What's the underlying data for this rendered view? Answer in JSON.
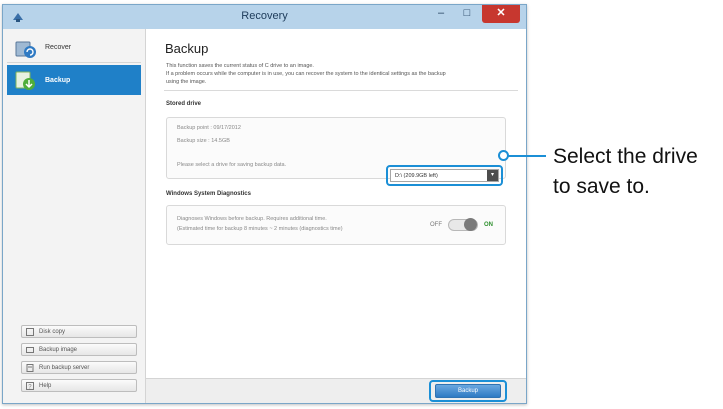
{
  "window": {
    "title": "Recovery",
    "minimize": "–",
    "maximize": "□",
    "close": "✕"
  },
  "sidebar": {
    "items": [
      {
        "label": "Recover",
        "icon": "recover-icon"
      },
      {
        "label": "Backup",
        "icon": "backup-icon",
        "selected": true
      }
    ],
    "buttons": [
      {
        "label": "Disk copy",
        "icon": "disk-icon"
      },
      {
        "label": "Backup image",
        "icon": "image-icon"
      },
      {
        "label": "Run backup server",
        "icon": "server-icon"
      },
      {
        "label": "Help",
        "icon": "help-icon"
      }
    ]
  },
  "main": {
    "title": "Backup",
    "description": [
      "This function saves the current status of C drive to an image.",
      "If a problem occurs while the computer is in use, you can recover the system to the identical settings as the backup",
      "using the image."
    ],
    "stored_drive": {
      "title": "Stored drive",
      "backup_point": "Backup point : 09/17/2012",
      "backup_size": "Backup size : 14.5GB",
      "select_prompt": "Please select a drive for saving backup data.",
      "drive_value": "D:\\ (209.9GB left)"
    },
    "diagnostics": {
      "title": "Windows System Diagnostics",
      "line1": "Diagnoses Windows before backup. Requires additional time.",
      "line2": "(Estimated time for backup 8 minutes ~ 2 minutes (diagnostics time)",
      "toggle_off": "OFF",
      "toggle_on": "ON",
      "toggle_state": "on"
    },
    "backup_button": "Backup"
  },
  "callout": {
    "line1": "Select the drive",
    "line2": "to save to."
  },
  "colors": {
    "accent": "#1b8fd6",
    "selected": "#1f80c8",
    "close": "#c7372f"
  }
}
